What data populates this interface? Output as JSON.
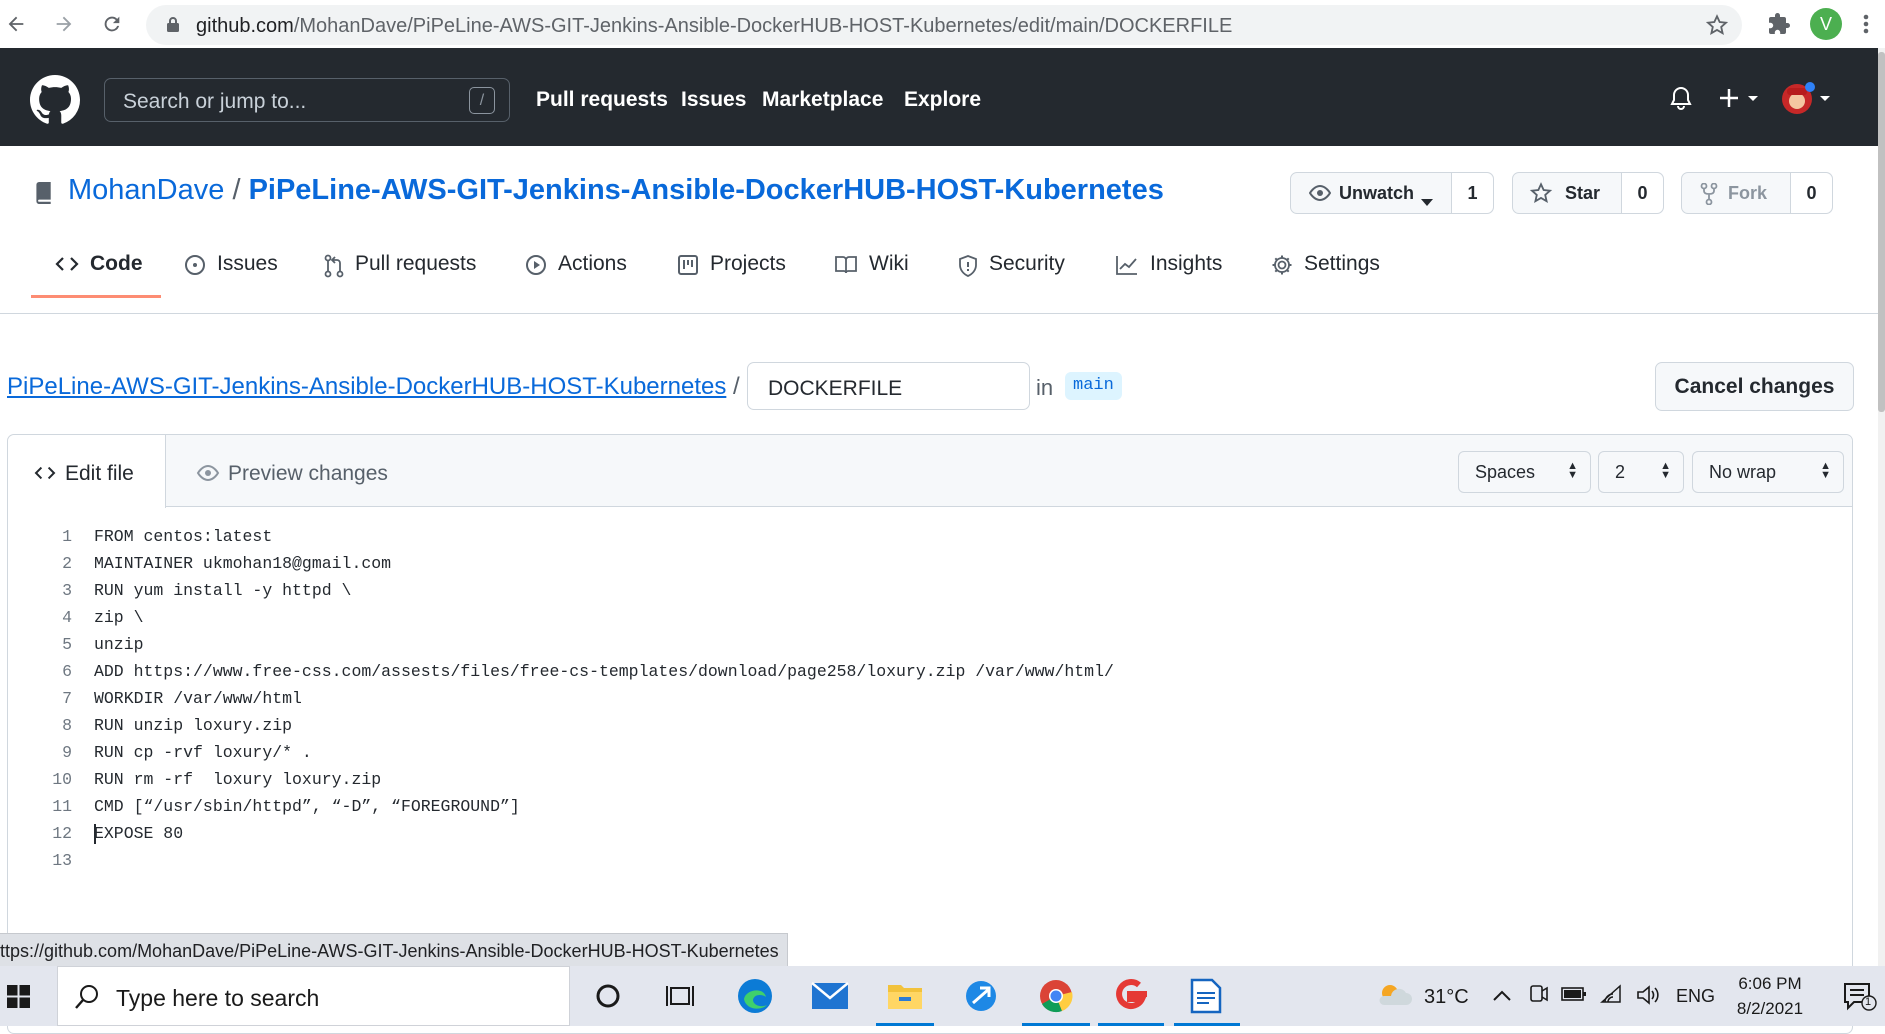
{
  "browser": {
    "url_host": "github.com",
    "url_path": "/MohanDave/PiPeLine-AWS-GIT-Jenkins-Ansible-DockerHUB-HOST-Kubernetes/edit/main/DOCKERFILE",
    "profile_initial": "V",
    "status_url": "ttps://github.com/MohanDave/PiPeLine-AWS-GIT-Jenkins-Ansible-DockerHUB-HOST-Kubernetes"
  },
  "github_header": {
    "search_placeholder": "Search or jump to...",
    "search_key": "/",
    "nav": [
      "Pull requests",
      "Issues",
      "Marketplace",
      "Explore"
    ]
  },
  "repo": {
    "owner": "MohanDave",
    "separator": "/",
    "name": "PiPeLine-AWS-GIT-Jenkins-Ansible-DockerHUB-HOST-Kubernetes",
    "watch_label": "Unwatch",
    "watch_count": "1",
    "star_label": "Star",
    "star_count": "0",
    "fork_label": "Fork",
    "fork_count": "0",
    "tabs": [
      "Code",
      "Issues",
      "Pull requests",
      "Actions",
      "Projects",
      "Wiki",
      "Security",
      "Insights",
      "Settings"
    ],
    "active_tab": "Code"
  },
  "edit": {
    "breadcrumb_repo": "PiPeLine-AWS-GIT-Jenkins-Ansible-DockerHUB-HOST-Kubernetes",
    "breadcrumb_sep": "/",
    "filename": "DOCKERFILE",
    "in_label": "in",
    "branch": "main",
    "cancel_label": "Cancel changes",
    "tab_edit": "Edit file",
    "tab_preview": "Preview changes",
    "indent_mode": "Spaces",
    "indent_size": "2",
    "wrap_mode": "No wrap"
  },
  "code_lines": [
    {
      "n": "1",
      "text": "FROM centos:latest"
    },
    {
      "n": "2",
      "text": "MAINTAINER ukmohan18@gmail.com"
    },
    {
      "n": "3",
      "text": "RUN yum install -y httpd \\"
    },
    {
      "n": "4",
      "text": "zip \\"
    },
    {
      "n": "5",
      "text": "unzip"
    },
    {
      "n": "6",
      "text": "ADD https://www.free-css.com/assests/files/free-cs-templates/download/page258/loxury.zip /var/www/html/"
    },
    {
      "n": "7",
      "text": "WORKDIR /var/www/html"
    },
    {
      "n": "8",
      "text": "RUN unzip loxury.zip"
    },
    {
      "n": "9",
      "text": "RUN cp -rvf loxury/* ."
    },
    {
      "n": "10",
      "text": "RUN rm -rf  loxury loxury.zip"
    },
    {
      "n": "11",
      "text": "CMD [“/usr/sbin/httpd”, “-D”, “FOREGROUND”]"
    },
    {
      "n": "12",
      "text": "EXPOSE 80"
    },
    {
      "n": "13",
      "text": ""
    }
  ],
  "taskbar": {
    "search_placeholder": "Type here to search",
    "weather": "31°C",
    "language": "ENG",
    "time": "6:06 PM",
    "date": "8/2/2021",
    "notification_count": "1"
  },
  "colors": {
    "github_header_bg": "#24292f",
    "link_blue": "#0969da",
    "active_tab_underline": "#fd8c73",
    "taskbar_bg": "#e3e6ee"
  }
}
